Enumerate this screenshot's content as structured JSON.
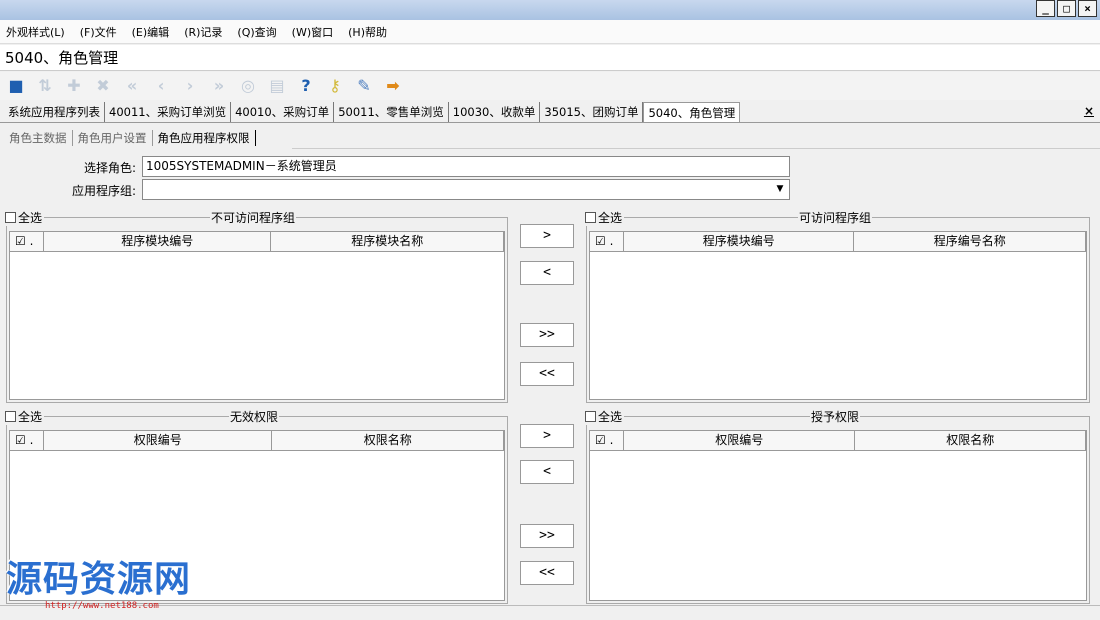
{
  "window": {
    "buttons": [
      "_",
      "□",
      "×"
    ]
  },
  "menu": [
    "外观样式(L)",
    "(F)文件",
    "(E)编辑",
    "(R)记录",
    "(Q)查询",
    "(W)窗口",
    "(H)帮助"
  ],
  "app_title": "5040、角色管理",
  "toolbar": [
    {
      "icon": "save-icon",
      "glyph": "■",
      "color": "#1f5fb0",
      "enabled": true
    },
    {
      "icon": "refresh-icon",
      "glyph": "⇅",
      "color": "#c2ccd8",
      "enabled": false
    },
    {
      "icon": "add-user-icon",
      "glyph": "✚",
      "color": "#c2ccd8",
      "enabled": false
    },
    {
      "icon": "delete-user-icon",
      "glyph": "✖",
      "color": "#c2ccd8",
      "enabled": false
    },
    {
      "icon": "first-record-icon",
      "glyph": "«",
      "color": "#c2ccd8",
      "enabled": false
    },
    {
      "icon": "previous-record-icon",
      "glyph": "‹",
      "color": "#c2ccd8",
      "enabled": false
    },
    {
      "icon": "next-record-icon",
      "glyph": "›",
      "color": "#c2ccd8",
      "enabled": false
    },
    {
      "icon": "last-record-icon",
      "glyph": "»",
      "color": "#c2ccd8",
      "enabled": false
    },
    {
      "icon": "search-icon",
      "glyph": "◎",
      "color": "#c2ccd8",
      "enabled": false
    },
    {
      "icon": "print-icon",
      "glyph": "▤",
      "color": "#c2ccd8",
      "enabled": false
    },
    {
      "icon": "help-icon",
      "glyph": "?",
      "color": "#1f5fb0",
      "enabled": true
    },
    {
      "icon": "key-icon",
      "glyph": "⚷",
      "color": "#d2b93a",
      "enabled": true
    },
    {
      "icon": "edit-form-icon",
      "glyph": "✎",
      "color": "#4e7fc0",
      "enabled": true
    },
    {
      "icon": "exit-icon",
      "glyph": "➡",
      "color": "#e08a1a",
      "enabled": true
    }
  ],
  "tabs": [
    "系统应用程序列表",
    "40011、采购订单浏览",
    "40010、采购订单",
    "50011、零售单浏览",
    "10030、收款单",
    "35015、团购订单",
    "5040、角色管理"
  ],
  "active_tab_index": 6,
  "tab_close": "×",
  "subtabs": [
    "角色主数据",
    "角色用户设置",
    "角色应用程序权限"
  ],
  "active_subtab_index": 2,
  "form": {
    "role_label": "选择角色:",
    "role_value": "1005SYSTEMADMIN－系统管理员",
    "group_label": "应用程序组:",
    "group_value": ""
  },
  "panels": {
    "inaccessible": {
      "select_all": "全选",
      "title": "不可访问程序组",
      "columns": [
        "☑ .",
        "程序模块编号",
        "程序模块名称"
      ]
    },
    "accessible": {
      "select_all": "全选",
      "title": "可访问程序组",
      "columns": [
        "☑ .",
        "程序模块编号",
        "程序编号名称"
      ]
    },
    "invalid": {
      "select_all": "全选",
      "title": "无效权限",
      "columns": [
        "☑ .",
        "权限编号",
        "权限名称"
      ]
    },
    "granted": {
      "select_all": "全选",
      "title": "授予权限",
      "columns": [
        "☑ .",
        "权限编号",
        "权限名称"
      ]
    }
  },
  "buttons": {
    "move_right": ">",
    "move_left": "<",
    "move_all_right": ">>",
    "move_all_left": "<<"
  },
  "watermark": {
    "text": "源码资源网",
    "url": "http://www.net188.com"
  }
}
